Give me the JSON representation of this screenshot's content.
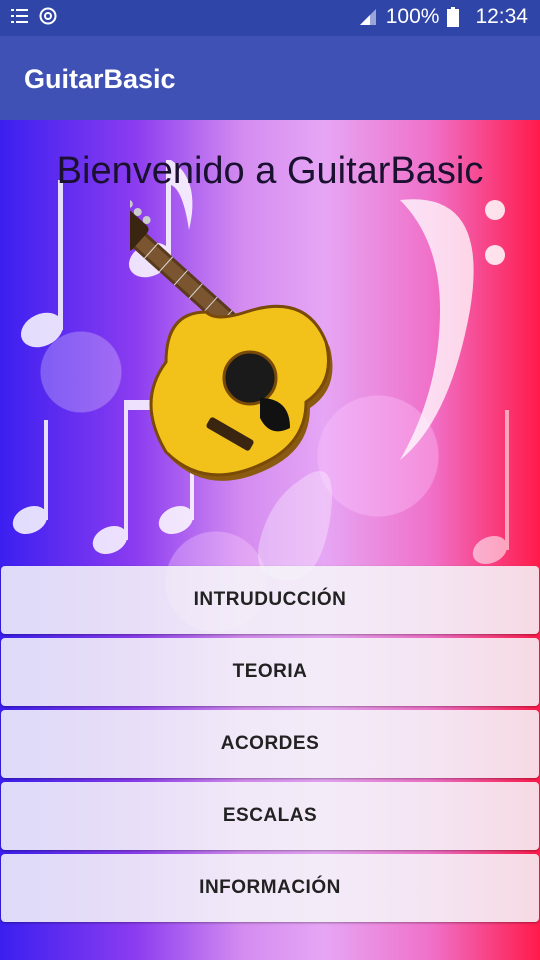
{
  "status_bar": {
    "battery_text": "100%",
    "time": "12:34",
    "icons": [
      "list-icon",
      "sync-icon",
      "signal-icon",
      "battery-icon"
    ]
  },
  "app_bar": {
    "title": "GuitarBasic"
  },
  "content": {
    "welcome": "Bienvenido a GuitarBasic"
  },
  "menu": {
    "items": [
      {
        "label": "INTRUDUCCIÓN"
      },
      {
        "label": "TEORIA"
      },
      {
        "label": "ACORDES"
      },
      {
        "label": "ESCALAS"
      },
      {
        "label": "INFORMACIÓN"
      }
    ]
  },
  "colors": {
    "status_bar": "#2f45a8",
    "app_bar": "#3f51b5",
    "guitar_body": "#f2c21a",
    "button_bg": "#f5f5f8"
  }
}
